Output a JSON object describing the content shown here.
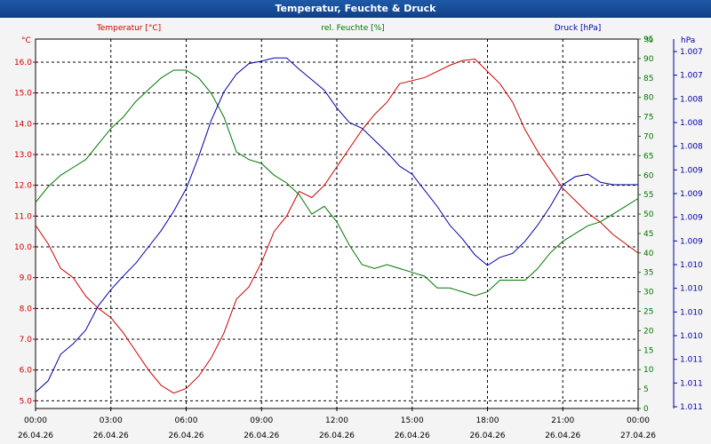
{
  "window": {
    "title": "Temperatur, Feuchte & Druck"
  },
  "colors": {
    "temperature": "#cc0000",
    "humidity": "#007700",
    "pressure": "#0000aa",
    "grid": "#000000",
    "axis_text": "#000000"
  },
  "chart_data": {
    "type": "line",
    "title": "Temperatur, Feuchte & Druck",
    "grid": true,
    "x_ticks": [
      {
        "time": "00:00",
        "date": "26.04.26"
      },
      {
        "time": "03:00",
        "date": "26.04.26"
      },
      {
        "time": "06:00",
        "date": "26.04.26"
      },
      {
        "time": "09:00",
        "date": "26.04.26"
      },
      {
        "time": "12:00",
        "date": "26.04.26"
      },
      {
        "time": "15:00",
        "date": "26.04.26"
      },
      {
        "time": "18:00",
        "date": "26.04.26"
      },
      {
        "time": "21:00",
        "date": "26.04.26"
      },
      {
        "time": "00:00",
        "date": "27.04.26"
      }
    ],
    "xlim": [
      "26.04.26 00:00",
      "27.04.26 00:00"
    ],
    "axes": {
      "temperature": {
        "label": "Temperatur [°C]",
        "unit": "°C",
        "ylim": [
          4.75,
          16.75
        ],
        "ticks": [
          "5.0",
          "6.0",
          "7.0",
          "8.0",
          "9.0",
          "10.0",
          "11.0",
          "12.0",
          "13.0",
          "14.0",
          "15.0",
          "16.0"
        ]
      },
      "humidity": {
        "label": "rel. Feuchte [%]",
        "unit": "%",
        "ylim": [
          0,
          95
        ],
        "ticks": [
          "0",
          "5",
          "10",
          "15",
          "20",
          "25",
          "30",
          "35",
          "40",
          "45",
          "50",
          "55",
          "60",
          "65",
          "70",
          "75",
          "80",
          "85",
          "90",
          "95"
        ]
      },
      "pressure": {
        "label": "Druck [hPa]",
        "unit": "hPa",
        "ticks": [
          "1.007",
          "1.007",
          "1.008",
          "1.008",
          "1.008",
          "1.009",
          "1.009",
          "1.009",
          "1.009",
          "1.010",
          "1.010",
          "1.010",
          "1.010",
          "1.011",
          "1.011",
          "1.011"
        ]
      }
    },
    "series": [
      {
        "name": "Temperatur [°C]",
        "axis": "temperature",
        "points": [
          [
            0.0,
            10.7
          ],
          [
            0.5,
            10.1
          ],
          [
            1.0,
            9.3
          ],
          [
            1.5,
            9.0
          ],
          [
            2.0,
            8.4
          ],
          [
            2.5,
            8.0
          ],
          [
            3.0,
            7.7
          ],
          [
            3.5,
            7.2
          ],
          [
            4.0,
            6.6
          ],
          [
            4.5,
            6.0
          ],
          [
            5.0,
            5.5
          ],
          [
            5.5,
            5.25
          ],
          [
            6.0,
            5.4
          ],
          [
            6.5,
            5.8
          ],
          [
            7.0,
            6.4
          ],
          [
            7.5,
            7.2
          ],
          [
            8.0,
            8.3
          ],
          [
            8.5,
            8.7
          ],
          [
            9.0,
            9.5
          ],
          [
            9.5,
            10.5
          ],
          [
            10.0,
            11.0
          ],
          [
            10.5,
            11.8
          ],
          [
            11.0,
            11.6
          ],
          [
            11.5,
            12.0
          ],
          [
            12.0,
            12.6
          ],
          [
            12.5,
            13.2
          ],
          [
            13.0,
            13.8
          ],
          [
            13.5,
            14.3
          ],
          [
            14.0,
            14.7
          ],
          [
            14.5,
            15.3
          ],
          [
            15.0,
            15.4
          ],
          [
            15.5,
            15.5
          ],
          [
            16.0,
            15.7
          ],
          [
            16.5,
            15.9
          ],
          [
            17.0,
            16.05
          ],
          [
            17.5,
            16.1
          ],
          [
            18.0,
            15.7
          ],
          [
            18.5,
            15.3
          ],
          [
            19.0,
            14.7
          ],
          [
            19.5,
            13.8
          ],
          [
            20.0,
            13.1
          ],
          [
            20.5,
            12.5
          ],
          [
            21.0,
            11.9
          ],
          [
            21.5,
            11.5
          ],
          [
            22.0,
            11.1
          ],
          [
            22.5,
            10.8
          ],
          [
            23.0,
            10.4
          ],
          [
            23.5,
            10.1
          ],
          [
            24.0,
            9.8
          ]
        ]
      },
      {
        "name": "rel. Feuchte [%]",
        "axis": "humidity",
        "points": [
          [
            0.0,
            53
          ],
          [
            0.5,
            57
          ],
          [
            1.0,
            60
          ],
          [
            1.5,
            62
          ],
          [
            2.0,
            64
          ],
          [
            2.5,
            68
          ],
          [
            3.0,
            72
          ],
          [
            3.5,
            75
          ],
          [
            4.0,
            79
          ],
          [
            4.5,
            82
          ],
          [
            5.0,
            85
          ],
          [
            5.5,
            87
          ],
          [
            6.0,
            87
          ],
          [
            6.5,
            85
          ],
          [
            7.0,
            81
          ],
          [
            7.5,
            75
          ],
          [
            8.0,
            66
          ],
          [
            8.5,
            64
          ],
          [
            9.0,
            63
          ],
          [
            9.5,
            60
          ],
          [
            10.0,
            58
          ],
          [
            10.5,
            55
          ],
          [
            11.0,
            50
          ],
          [
            11.5,
            52
          ],
          [
            12.0,
            48
          ],
          [
            12.5,
            42
          ],
          [
            13.0,
            37
          ],
          [
            13.5,
            36
          ],
          [
            14.0,
            37
          ],
          [
            14.5,
            36
          ],
          [
            15.0,
            35
          ],
          [
            15.5,
            34
          ],
          [
            16.0,
            31
          ],
          [
            16.5,
            31
          ],
          [
            17.0,
            30
          ],
          [
            17.5,
            29
          ],
          [
            18.0,
            30
          ],
          [
            18.5,
            33
          ],
          [
            19.0,
            33
          ],
          [
            19.5,
            33
          ],
          [
            20.0,
            36
          ],
          [
            20.5,
            40
          ],
          [
            21.0,
            43
          ],
          [
            21.5,
            45
          ],
          [
            22.0,
            47
          ],
          [
            22.5,
            48
          ],
          [
            23.0,
            50
          ],
          [
            23.5,
            52
          ],
          [
            24.0,
            54
          ]
        ]
      },
      {
        "name": "Druck [hPa]",
        "axis": "pressure",
        "points": [
          [
            0.0,
            1.00698
          ],
          [
            0.5,
            1.00712
          ],
          [
            1.0,
            1.00745
          ],
          [
            1.5,
            1.00758
          ],
          [
            2.0,
            1.00775
          ],
          [
            2.5,
            1.00805
          ],
          [
            3.0,
            1.00825
          ],
          [
            3.5,
            1.00842
          ],
          [
            4.0,
            1.00858
          ],
          [
            4.5,
            1.00878
          ],
          [
            5.0,
            1.00898
          ],
          [
            5.5,
            1.00922
          ],
          [
            6.0,
            1.0095
          ],
          [
            6.5,
            1.0099
          ],
          [
            7.0,
            1.01035
          ],
          [
            7.5,
            1.0107
          ],
          [
            8.0,
            1.01092
          ],
          [
            8.5,
            1.01105
          ],
          [
            9.0,
            1.01108
          ],
          [
            9.5,
            1.01112
          ],
          [
            10.0,
            1.01112
          ],
          [
            10.5,
            1.01098
          ],
          [
            11.0,
            1.01085
          ],
          [
            11.5,
            1.01072
          ],
          [
            12.0,
            1.0105
          ],
          [
            12.5,
            1.01032
          ],
          [
            13.0,
            1.01025
          ],
          [
            13.5,
            1.0101
          ],
          [
            14.0,
            1.00995
          ],
          [
            14.5,
            1.00978
          ],
          [
            15.0,
            1.00968
          ],
          [
            15.5,
            1.00948
          ],
          [
            16.0,
            1.00928
          ],
          [
            16.5,
            1.00905
          ],
          [
            17.0,
            1.00888
          ],
          [
            17.5,
            1.00868
          ],
          [
            18.0,
            1.00855
          ],
          [
            18.5,
            1.00865
          ],
          [
            19.0,
            1.0087
          ],
          [
            19.5,
            1.00885
          ],
          [
            20.0,
            1.00905
          ],
          [
            20.5,
            1.00928
          ],
          [
            21.0,
            1.00955
          ],
          [
            21.5,
            1.00965
          ],
          [
            22.0,
            1.00968
          ],
          [
            22.5,
            1.00958
          ],
          [
            23.0,
            1.00955
          ],
          [
            23.5,
            1.00955
          ],
          [
            24.0,
            1.00955
          ]
        ]
      }
    ]
  }
}
